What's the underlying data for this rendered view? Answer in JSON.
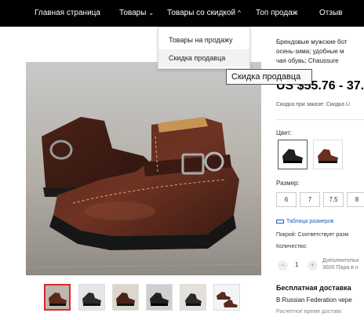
{
  "nav": {
    "items": [
      {
        "label": "Главная страница"
      },
      {
        "label": "Товары"
      },
      {
        "label": "Товары со скидкой"
      },
      {
        "label": "Топ продаж"
      },
      {
        "label": "Отзыв"
      }
    ]
  },
  "dropdown": {
    "items": [
      {
        "label": "Товары на продажу"
      },
      {
        "label": "Скидка продавца"
      }
    ]
  },
  "tooltip": {
    "text": "Скидка продавца"
  },
  "product": {
    "title_lines": [
      "Брендовые мужские бот",
      "осень-зима; удобные м",
      "чая обувь; Chaussure"
    ],
    "price": "US $55.76 - 37.",
    "discount_note": "Скидка при заказе: Скидка U",
    "color_label": "Цвет:",
    "size_label": "Размер:",
    "sizes": [
      "6",
      "7",
      "7.5",
      "8"
    ],
    "size_chart": "Таблица размеров",
    "fit": "Покрой: Соответствует разм",
    "quantity_label": "Количество:",
    "quantity": "1",
    "quantity_minus": "−",
    "quantity_plus": "+",
    "quantity_extra": [
      "Дополнительн",
      "3600 Пара в н"
    ]
  },
  "shipping": {
    "title": "Бесплатная доставка",
    "destination": "В Russian Federation чере",
    "time": "Расчетное время доставк"
  },
  "colors": {
    "accent": "#e0252a",
    "nav_bg": "#000000",
    "link": "#1a5fb4"
  },
  "icons": {
    "caret_down": "chevron-down-icon",
    "caret_up": "chevron-up-icon",
    "ruler": "ruler-icon"
  }
}
